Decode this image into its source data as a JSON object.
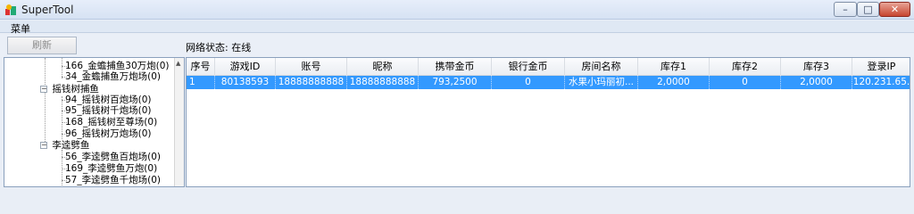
{
  "window": {
    "title": "SuperTool",
    "min_glyph": "–",
    "max_glyph": "□",
    "close_glyph": "✕"
  },
  "menu": {
    "item": "菜单"
  },
  "toolbar": {
    "refresh_label": "刷新",
    "status": "网络状态: 在线"
  },
  "tree": {
    "items": [
      {
        "label": "166_金蟾捕鱼30万炮(0)",
        "type": "leaf"
      },
      {
        "label": "34_金蟾捕鱼万炮场(0)",
        "type": "leaf"
      },
      {
        "label": "摇钱树捕鱼",
        "type": "group",
        "toggle": "−"
      },
      {
        "label": "94_摇钱树百炮场(0)",
        "type": "leaf"
      },
      {
        "label": "95_摇钱树千炮场(0)",
        "type": "leaf"
      },
      {
        "label": "168_摇钱树至尊场(0)",
        "type": "leaf"
      },
      {
        "label": "96_摇钱树万炮场(0)",
        "type": "leaf"
      },
      {
        "label": "李逵劈鱼",
        "type": "group",
        "toggle": "−"
      },
      {
        "label": "56_李逵劈鱼百炮场(0)",
        "type": "leaf"
      },
      {
        "label": "169_李逵劈鱼万炮(0)",
        "type": "leaf"
      },
      {
        "label": "57_李逵劈鱼千炮场(0)",
        "type": "leaf"
      }
    ]
  },
  "grid": {
    "columns": [
      "序号",
      "游戏ID",
      "账号",
      "昵称",
      "携带金币",
      "银行金币",
      "房间名称",
      "库存1",
      "库存2",
      "库存3",
      "登录IP"
    ],
    "rows": [
      [
        "1",
        "80138593",
        "18888888888",
        "18888888888",
        "793,2500",
        "0",
        "水果小玛丽初...",
        "2,0000",
        "0",
        "2,0000",
        "120.231.65."
      ]
    ]
  },
  "colors": {
    "selection": "#3399ff",
    "titlebar": "#dbe6f5"
  }
}
